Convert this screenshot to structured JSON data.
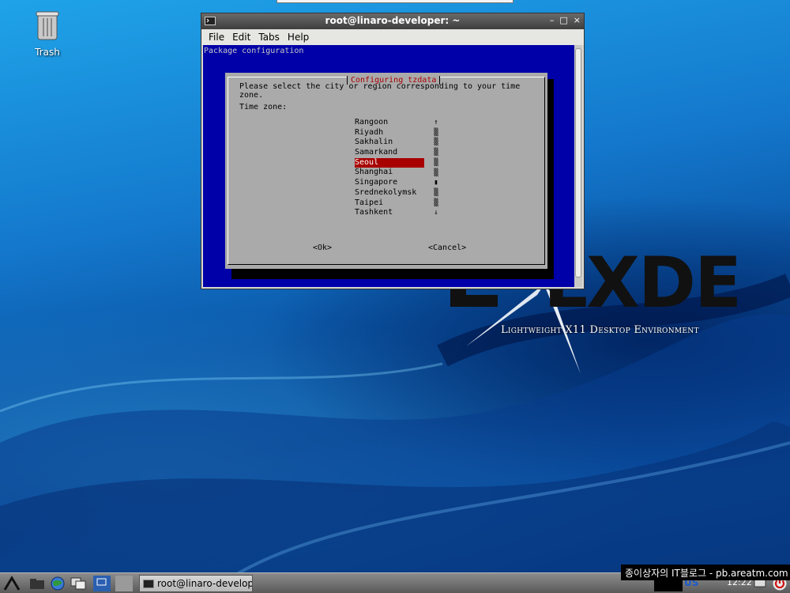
{
  "desktop": {
    "trash_label": "Trash",
    "logo_word": "LXDE",
    "tagline": "Lightweight X11 Desktop Environment"
  },
  "window": {
    "title": "root@linaro-developer: ~",
    "controls": [
      "–",
      "□",
      "×"
    ],
    "menu": [
      "File",
      "Edit",
      "Tabs",
      "Help"
    ]
  },
  "terminal": {
    "header": "Package configuration",
    "dialog": {
      "title": "Configuring tzdata",
      "prompt": "Please select the city or region corresponding to your time zone.",
      "tz_label": "Time zone:",
      "items": [
        "Rangoon",
        "Riyadh",
        "Sakhalin",
        "Samarkand",
        "Seoul",
        "Shanghai",
        "Singapore",
        "Srednekolymsk",
        "Taipei",
        "Tashkent"
      ],
      "selected": "Seoul",
      "scroll_glyphs": [
        "↑",
        "▒",
        "▒",
        "▒",
        "▒",
        "▒",
        "▮",
        "▒",
        "▒",
        "↓"
      ],
      "ok_label": "<Ok>",
      "cancel_label": "<Cancel>"
    }
  },
  "taskbar": {
    "task_label": "root@linaro-develope⋯",
    "keyboard_layout": "US",
    "clock": "12:22"
  },
  "watermark": "종이상자의 IT블로그 - pb.areatm.com",
  "colors": {
    "terminal_bg": "#0000a8",
    "dialog_bg": "#aaaaaa",
    "selection": "#a80000",
    "title_color": "#a80000"
  }
}
